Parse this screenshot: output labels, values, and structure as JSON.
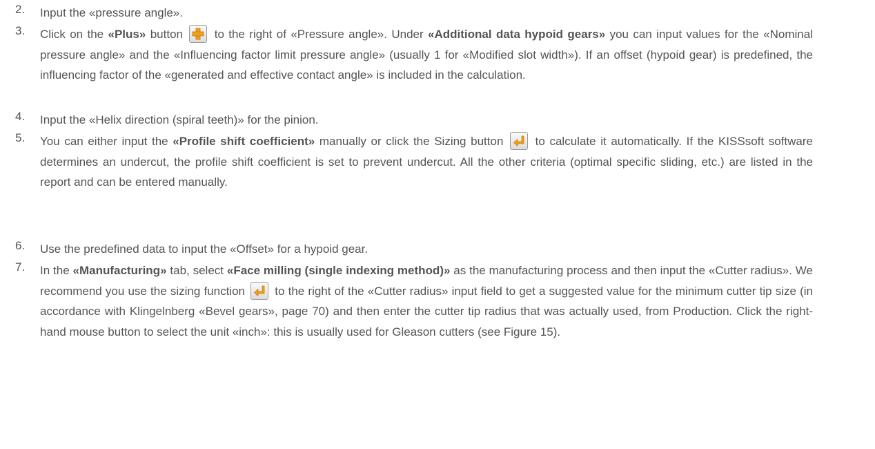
{
  "steps": [
    {
      "number": "2.",
      "text": [
        "Input the «pressure angle»."
      ]
    },
    {
      "number": "3.",
      "text": [
        "Click on the ",
        "«Plus»",
        " button ",
        " to the right of «Pressure angle». Under ",
        "«Additional data hypoid gears»",
        " you can input values for the «Nominal pressure angle» and the «Influencing factor limit pressure angle» (usually 1 for «Modified slot width»). If an offset (hypoid gear) is predefined, the influencing factor of the «generated and effective contact angle» is included in the calculation."
      ]
    },
    {
      "number": "4.",
      "text": [
        "Input the «Helix direction (spiral teeth)» for the pinion."
      ]
    },
    {
      "number": "5.",
      "text": [
        "You can either input the ",
        "«Profile shift coefficient»",
        " manually or click the Sizing button ",
        " to calculate it automatically. If the KISSsoft software determines an undercut, the profile shift coefficient is set to prevent undercut. All the other criteria (optimal specific sliding, etc.) are listed in the report and can be entered manually."
      ]
    },
    {
      "number": "6.",
      "text": [
        "Use the predefined data to input the «Offset» for a hypoid gear."
      ]
    },
    {
      "number": "7.",
      "text": [
        "In the ",
        "«Manufacturing»",
        " tab, select ",
        "«Face milling (single indexing method)»",
        " as the manufacturing process and then input the «Cutter radius». We recommend you use the sizing function ",
        " to the right of the «Cutter radius» input field to get a suggested value for the minimum cutter tip size (in accordance with Klingelnberg «Bevel gears», page 70) and then enter the cutter tip radius that was actually used, from Production. Click the right-hand mouse button to select the unit «inch»: this is usually used for Gleason cutters (see Figure 15)."
      ]
    }
  ],
  "icons": {
    "plus": "plus-icon",
    "sizing": "sizing-arrow-icon"
  },
  "colors": {
    "text": "#545454",
    "icon_orange": "#f0a020",
    "icon_border": "#9a9a9a"
  }
}
